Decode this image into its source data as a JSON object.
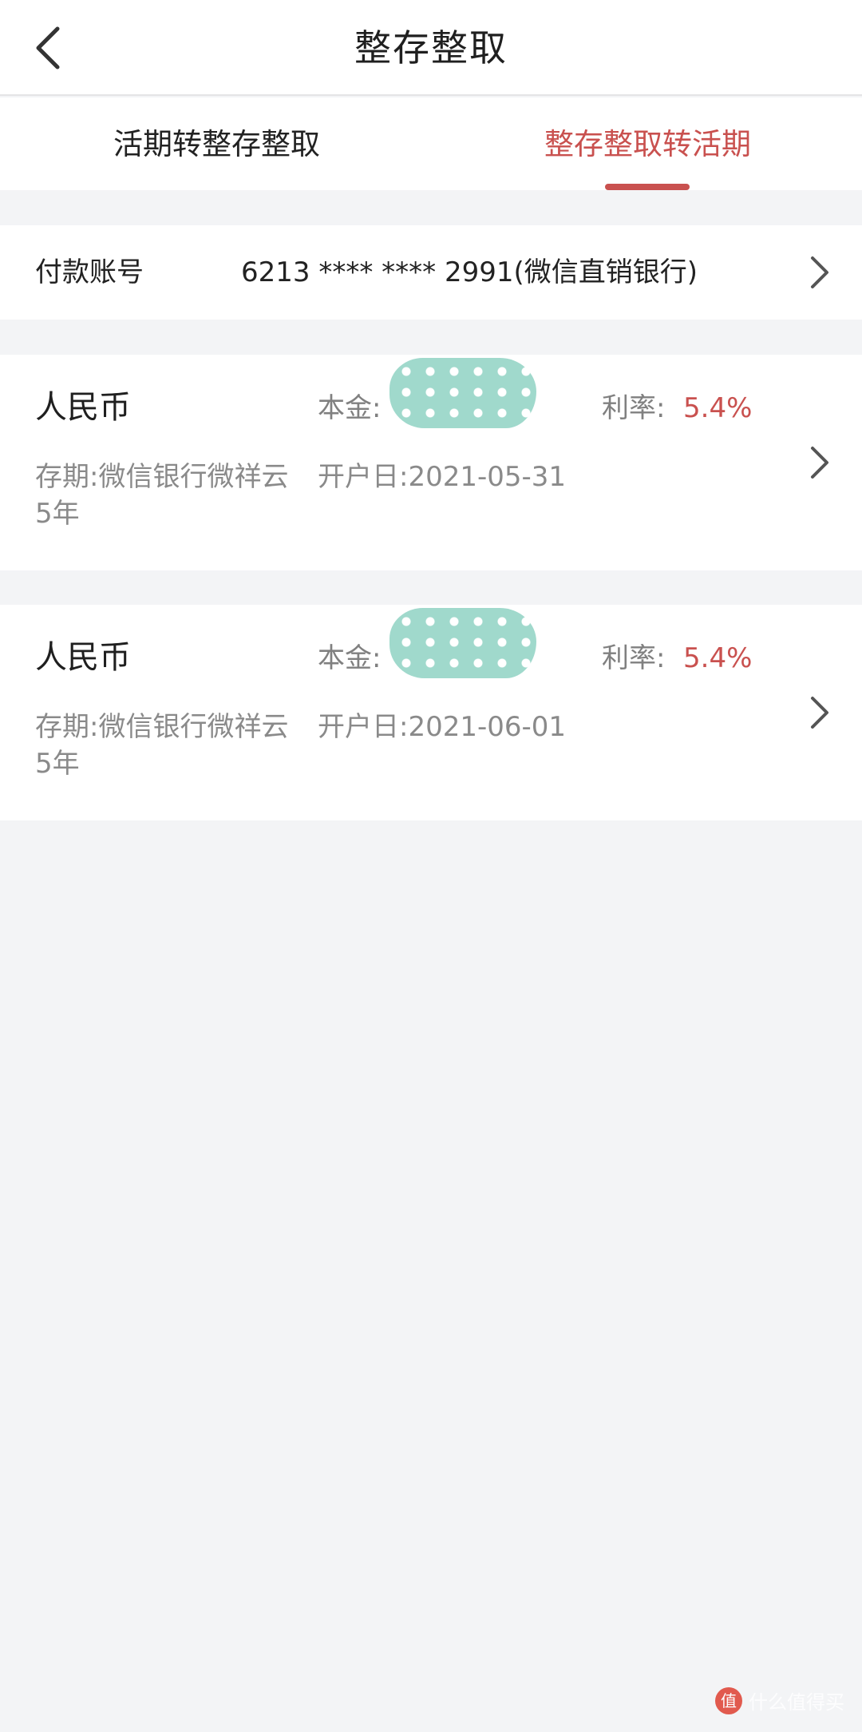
{
  "header": {
    "title": "整存整取"
  },
  "tabs": [
    {
      "label": "活期转整存整取",
      "active": false
    },
    {
      "label": "整存整取转活期",
      "active": true
    }
  ],
  "account": {
    "label": "付款账号",
    "value": "6213 **** **** 2991(微信直销银行)"
  },
  "deposits": [
    {
      "currency": "人民币",
      "principal_label": "本金:",
      "rate_label": "利率:",
      "rate": "5.4%",
      "term_label": "存期:",
      "product": "微信银行微祥云",
      "term": "5年",
      "open_date_label": "开户日:",
      "open_date": "2021-05-31"
    },
    {
      "currency": "人民币",
      "principal_label": "本金:",
      "rate_label": "利率:",
      "rate": "5.4%",
      "term_label": "存期:",
      "product": "微信银行微祥云",
      "term": "5年",
      "open_date_label": "开户日:",
      "open_date": "2021-06-01"
    }
  ],
  "watermark": {
    "logo": "值",
    "text": "什么值得买"
  },
  "colors": {
    "accent": "#c9514f",
    "background": "#f3f4f6",
    "redaction": "#a0d9cc"
  },
  "icons": {
    "back": "back-arrow-icon",
    "chevron": "chevron-right-icon"
  }
}
